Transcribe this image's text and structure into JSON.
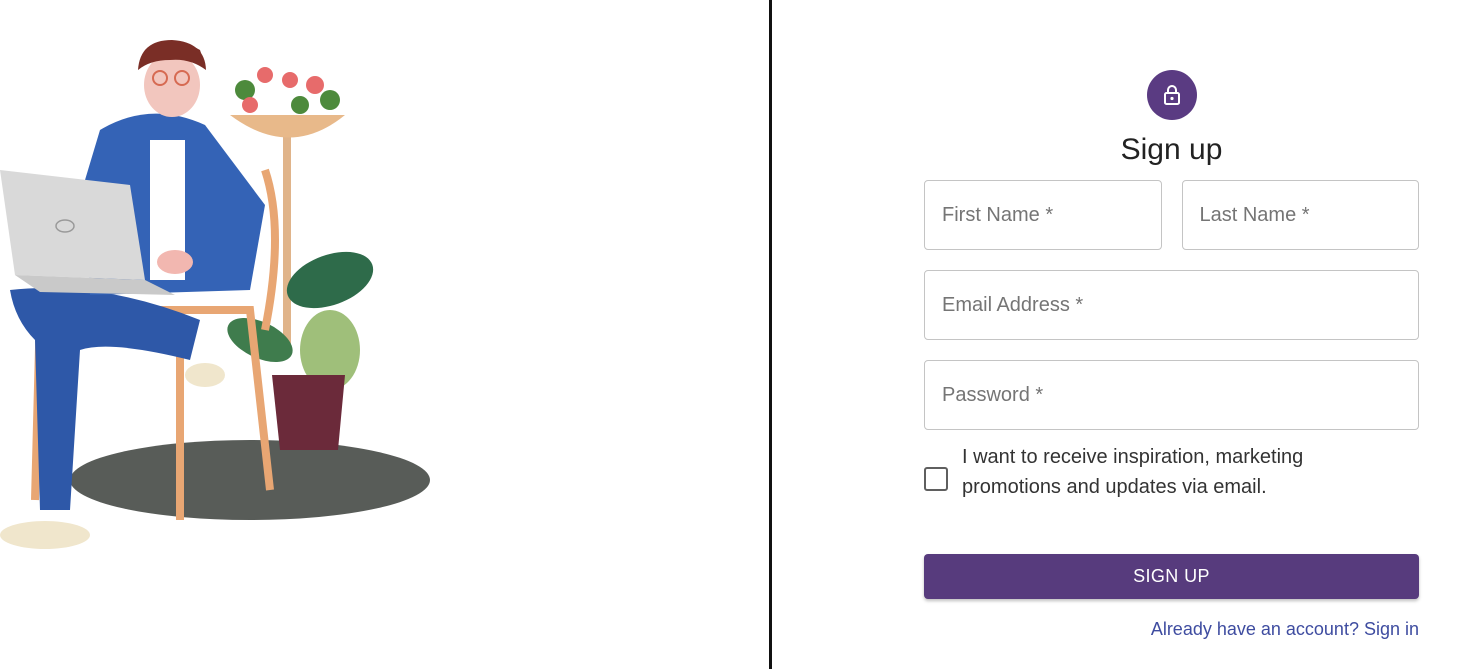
{
  "form": {
    "title": "Sign up",
    "lock_icon": "lock-icon",
    "first_name_placeholder": "First Name *",
    "last_name_placeholder": "Last Name *",
    "email_placeholder": "Email Address *",
    "password_placeholder": "Password *",
    "marketing_checkbox_label": "I want to receive inspiration, marketing promotions and updates via email.",
    "submit_label": "SIGN UP",
    "signin_link": "Already have an account? Sign in"
  },
  "colors": {
    "accent": "#573b7d",
    "link": "#3e4ca0",
    "divider": "#111111"
  }
}
